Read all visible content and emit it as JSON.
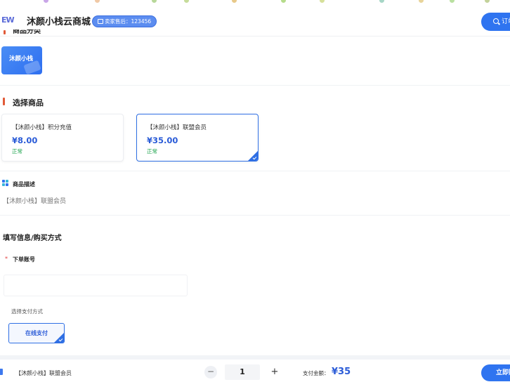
{
  "header": {
    "logo_text": "EW",
    "site_title": "沐颜小栈云商城",
    "after_sale_label": "卖家售后：123456",
    "order_button_label": "订单"
  },
  "category": {
    "section_title": "商品分类",
    "items": [
      {
        "label": "沐颜小栈",
        "selected": true
      }
    ]
  },
  "products": {
    "section_title": "选择商品",
    "items": [
      {
        "name": "【沐颜小栈】积分充值",
        "price": "¥8.00",
        "status": "正常",
        "selected": false
      },
      {
        "name": "【沐颜小栈】联盟会员",
        "price": "¥35.00",
        "status": "正常",
        "selected": true
      }
    ]
  },
  "description": {
    "label": "商品描述",
    "text": "【沐颜小栈】联盟会员"
  },
  "form": {
    "title": "填写信息/购买方式",
    "account_required_mark": "*",
    "account_label": "下单账号",
    "account_value": "",
    "payment_label": "选择支付方式",
    "payment_options": [
      {
        "label": "在线支付",
        "selected": true
      }
    ]
  },
  "footer": {
    "product_name": "【沐颜小栈】联盟会员",
    "minus_label": "−",
    "quantity": "1",
    "plus_label": "+",
    "total_label": "支付金额：",
    "total_value": "¥35",
    "buy_button_label": "立即购买"
  },
  "colors": {
    "accent": "#2f74f0",
    "price": "#2a5bd7",
    "status_ok": "#1aa24a",
    "section_mark": "#e15a38",
    "required": "#e23b3b"
  }
}
